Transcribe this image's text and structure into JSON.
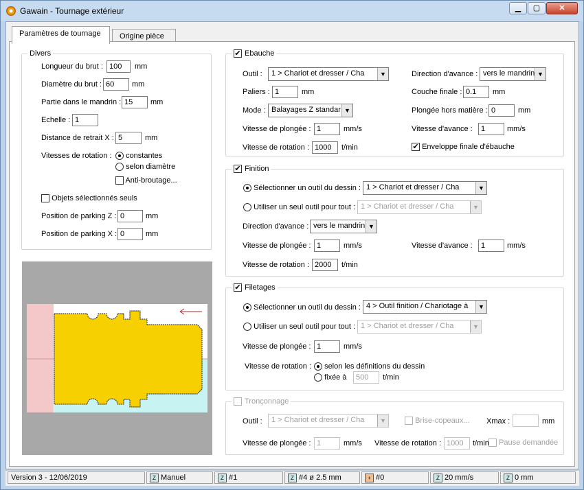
{
  "window": {
    "app": "Gawain",
    "sep": " - ",
    "title": "Tournage extérieur"
  },
  "tabs": [
    "Paramètres de tournage",
    "Origine pièce"
  ],
  "divers": {
    "title": "Divers",
    "longueur_label": "Longueur du brut :",
    "longueur_value": "100",
    "longueur_unit": "mm",
    "diametre_label": "Diamètre du brut :",
    "diametre_value": "60",
    "diametre_unit": "mm",
    "partie_label": "Partie dans le mandrin :",
    "partie_value": "15",
    "partie_unit": "mm",
    "echelle_label": "Echelle :",
    "echelle_value": "1",
    "retrait_label": "Distance de retrait X :",
    "retrait_value": "5",
    "retrait_unit": "mm",
    "vitesses_label": "Vitesses de rotation :",
    "constantes": "constantes",
    "selon_diametre": "selon diamètre",
    "anti_broutage": "Anti-broutage...",
    "objets": "Objets sélectionnés seuls",
    "parkz_label": "Position de parking Z :",
    "parkz_value": "0",
    "parkz_unit": "mm",
    "parkx_label": "Position de parking X :",
    "parkx_value": "0",
    "parkx_unit": "mm"
  },
  "ebauche": {
    "title": "Ebauche",
    "outil_label": "Outil :",
    "outil_value": "1 >  Chariot et dresser  /  Cha",
    "paliers_label": "Paliers :",
    "paliers_value": "1",
    "paliers_unit": "mm",
    "mode_label": "Mode :",
    "mode_value": "Balayages Z standar",
    "plongee_label": "Vitesse de plongée :",
    "plongee_value": "1",
    "plongee_unit": "mm/s",
    "rotation_label": "Vitesse de rotation :",
    "rotation_value": "1000",
    "rotation_unit": "t/min",
    "direction_label": "Direction d'avance :",
    "direction_value": "vers le mandrin",
    "couche_label": "Couche finale :",
    "couche_value": "0.1",
    "couche_unit": "mm",
    "plongee_hm_label": "Plongée hors matière :",
    "plongee_hm_value": "0",
    "plongee_hm_unit": "mm",
    "avance_label": "Vitesse d'avance :",
    "avance_value": "1",
    "avance_unit": "mm/s",
    "enveloppe": "Enveloppe finale d'ébauche"
  },
  "finition": {
    "title": "Finition",
    "opt1": "Sélectionner un outil du dessin :",
    "opt1_value": "1 >  Chariot et dresser  /  Cha",
    "opt2": "Utiliser un seul outil pour tout :",
    "opt2_value": "1 >  Chariot et dresser  /  Cha",
    "direction_label": "Direction d'avance :",
    "direction_value": "vers le mandrin",
    "plongee_label": "Vitesse de plongée :",
    "plongee_value": "1",
    "plongee_unit": "mm/s",
    "avance_label": "Vitesse d'avance :",
    "avance_value": "1",
    "avance_unit": "mm/s",
    "rotation_label": "Vitesse de rotation :",
    "rotation_value": "2000",
    "rotation_unit": "t/min"
  },
  "filetages": {
    "title": "Filetages",
    "opt1": "Sélectionner un outil du dessin :",
    "opt1_value": "4 >  Outil finition  /  Chariotage à",
    "opt2": "Utiliser un seul outil pour tout :",
    "opt2_value": "1 >  Chariot et dresser  /  Cha",
    "plongee_label": "Vitesse de plongée :",
    "plongee_value": "1",
    "plongee_unit": "mm/s",
    "rotation_label": "Vitesse de rotation :",
    "selon": "selon les définitions du dessin",
    "fixee": "fixée à",
    "fixee_value": "500",
    "fixee_unit": "t/min"
  },
  "tronconnage": {
    "title": "Tronçonnage",
    "outil_label": "Outil :",
    "outil_value": "1 >  Chariot et dresser  /  Cha",
    "brise": "Brise-copeaux...",
    "xmax_label": "Xmax :",
    "xmax_unit": "mm",
    "plongee_label": "Vitesse de plongée :",
    "plongee_value": "1",
    "plongee_unit": "mm/s",
    "rotation_label": "Vitesse de rotation :",
    "rotation_value": "1000",
    "rotation_unit": "t/min",
    "pause": "Pause demandée"
  },
  "statusbar": {
    "version": "Version 3 - 12/06/2019",
    "mode": "Manuel",
    "tool_num": "#1",
    "tool_info": "#4  ø 2.5 mm",
    "origin": "#0",
    "speed": "20 mm/s",
    "pos": "0 mm"
  }
}
